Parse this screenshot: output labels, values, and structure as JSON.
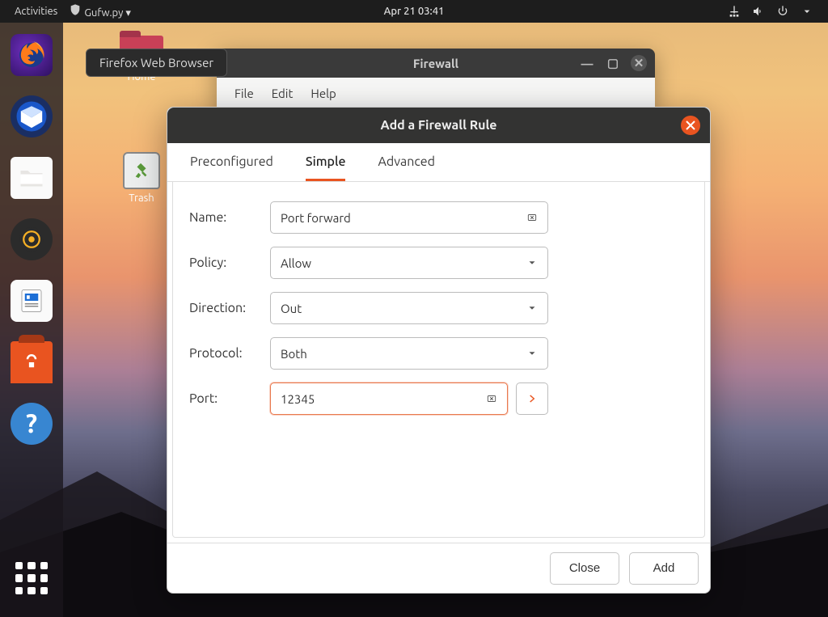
{
  "topbar": {
    "activities": "Activities",
    "app_indicator": "Gufw.py ▾",
    "clock": "Apr 21  03:41"
  },
  "tooltip": "Firefox Web Browser",
  "desktop": {
    "home": "Home",
    "trash": "Trash"
  },
  "firewall_window": {
    "title": "Firewall",
    "menus": {
      "file": "File",
      "edit": "Edit",
      "help": "Help"
    }
  },
  "dialog": {
    "title": "Add a Firewall Rule",
    "tabs": {
      "preconfigured": "Preconfigured",
      "simple": "Simple",
      "advanced": "Advanced"
    },
    "labels": {
      "name": "Name:",
      "policy": "Policy:",
      "direction": "Direction:",
      "protocol": "Protocol:",
      "port": "Port:"
    },
    "values": {
      "name": "Port forward",
      "policy": "Allow",
      "direction": "Out",
      "protocol": "Both",
      "port": "12345"
    },
    "buttons": {
      "close": "Close",
      "add": "Add"
    }
  },
  "dock_help": "?"
}
